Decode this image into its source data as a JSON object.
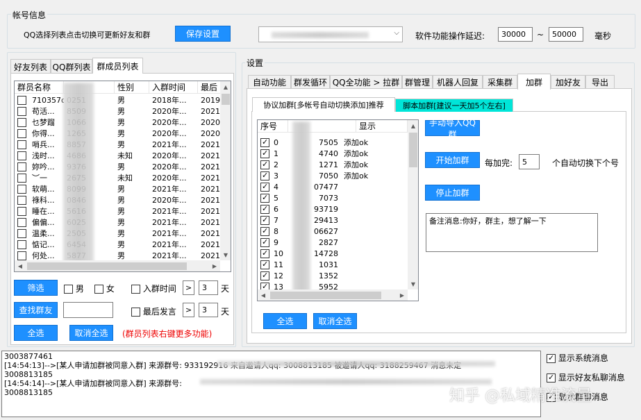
{
  "account": {
    "title": "帐号信息",
    "hint": "QQ选择列表点击切换可更新好友和群",
    "save": "保存设置",
    "delay_label": "软件功能操作延迟:",
    "delay_min": "30000",
    "delay_sep": "~",
    "delay_max": "50000",
    "delay_unit": "毫秒"
  },
  "left_tabs": [
    "好友列表",
    "QQ群列表",
    "群成员列表"
  ],
  "members": {
    "headers": [
      "群员名称",
      "",
      "性别",
      "入群时间",
      "最后"
    ],
    "rows": [
      [
        "710357d",
        "0251",
        "男",
        "2018年...",
        "2019"
      ],
      [
        "苟活...",
        "8509",
        "男",
        "2020年...",
        "2021"
      ],
      [
        "乜梦蹓",
        "1066",
        "男",
        "2020年...",
        "2020"
      ],
      [
        "你得...",
        "1265",
        "男",
        "2020年...",
        "2020"
      ],
      [
        "哨兵...",
        "8857",
        "男",
        "2021年...",
        "2021"
      ],
      [
        "浅时...",
        "4686",
        "未知",
        "2020年...",
        "2021"
      ],
      [
        "妳吟...",
        "9376",
        "男",
        "2020年...",
        "2021"
      ],
      [
        "︶一",
        "2675",
        "未知",
        "2020年...",
        "2021"
      ],
      [
        "软萌...",
        "8099",
        "男",
        "2021年...",
        "2021"
      ],
      [
        "祿科...",
        "0846",
        "男",
        "2020年...",
        "2021"
      ],
      [
        "睡在...",
        "5616",
        "男",
        "2021年...",
        "2021"
      ],
      [
        "偏偏...",
        "6025",
        "男",
        "2021年...",
        "2021"
      ],
      [
        "温柔...",
        "2505",
        "男",
        "2021年...",
        "2021"
      ],
      [
        "惦记...",
        "6454",
        "男",
        "2021年...",
        "2021"
      ],
      [
        "何处...",
        "5877",
        "男",
        "2021年...",
        "2021"
      ]
    ]
  },
  "filter": {
    "btn": "筛选",
    "male": "男",
    "female": "女",
    "join_time": "入群时间",
    "last_speak": "最后发言",
    "days1": "3",
    "days2": "3",
    "day": "天",
    "arrow": ">",
    "find": "查找群友",
    "select_all": "全选",
    "cancel_all": "取消全选",
    "note": "(群员列表右键更多功能)"
  },
  "settings": {
    "title": "设置",
    "tabs": [
      "自动功能",
      "群发循环",
      "QQ全功能 > 拉群",
      "群管理",
      "机器人回复",
      "采集群",
      "加群",
      "加好友",
      "导出"
    ]
  },
  "subtabs": [
    "协议加群[多帐号自动切换添加]推荐",
    "脚本加群[建议一天加5个左右]"
  ],
  "groups": {
    "headers": [
      "序号",
      "",
      "显示"
    ],
    "rows": [
      [
        "0",
        "7505",
        "添加ok"
      ],
      [
        "1",
        "4740",
        "添加ok"
      ],
      [
        "2",
        "1271",
        "添加ok"
      ],
      [
        "3",
        "7050",
        "添加ok"
      ],
      [
        "4",
        "07477",
        ""
      ],
      [
        "5",
        "7073",
        ""
      ],
      [
        "6",
        "93719",
        ""
      ],
      [
        "7",
        "29413",
        ""
      ],
      [
        "8",
        "06627",
        ""
      ],
      [
        "9",
        "2827",
        ""
      ],
      [
        "10",
        "14728",
        ""
      ],
      [
        "11",
        "1031",
        ""
      ],
      [
        "12",
        "1352",
        ""
      ],
      [
        "13",
        "5952",
        ""
      ]
    ]
  },
  "join": {
    "import": "手动导入QQ群",
    "start": "开始加群",
    "every": "每加完:",
    "every_val": "5",
    "switch_label": "个自动切换下个号",
    "stop": "停止加群",
    "remark": "备注消息:你好，群主，想了解一下",
    "select_all": "全选",
    "cancel_all": "取消全选"
  },
  "log": [
    "3003877461",
    "[14:54:13]-->[某人申请加群被同意入群] 来源群号: 933192916  来自邀请人qq: 3008813185  被邀请人qq: 3188259467  消息未定",
    "3008813185",
    "[14:54:14]-->[某人申请加群被同意入群] 来源群号:",
    "3008813185"
  ],
  "options": {
    "sys": "显示系统消息",
    "friend": "显示好友私聊消息",
    "group": "显示群聊消息"
  },
  "watermark": "知乎 @私域精准流量"
}
